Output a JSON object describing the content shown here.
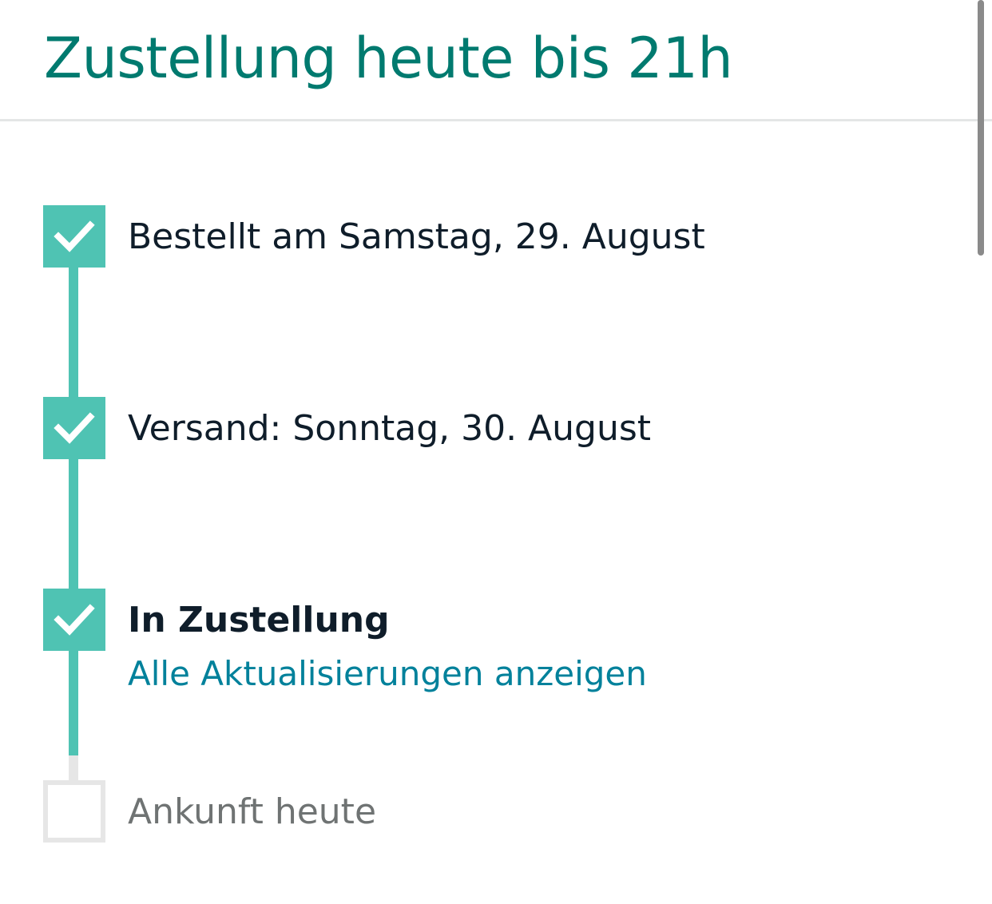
{
  "header": {
    "title": "Zustellung heute bis 21h"
  },
  "steps": [
    {
      "label": "Bestellt am Samstag, 29. August",
      "status": "done",
      "icon": "checkmark-icon"
    },
    {
      "label": "Versand: Sonntag, 30. August",
      "status": "done",
      "icon": "checkmark-icon"
    },
    {
      "label": "In Zustellung",
      "status": "current",
      "icon": "checkmark-icon",
      "link": "Alle Aktualisierungen anzeigen"
    },
    {
      "label": "Ankunft heute",
      "status": "pending",
      "icon": "empty-checkbox-icon"
    }
  ],
  "colors": {
    "title": "#007a6f",
    "progress": "#4fc3b3",
    "pending": "#e6e6e6",
    "link": "#00819b",
    "text": "#0f1d2a",
    "muted_text": "#6f7373"
  }
}
